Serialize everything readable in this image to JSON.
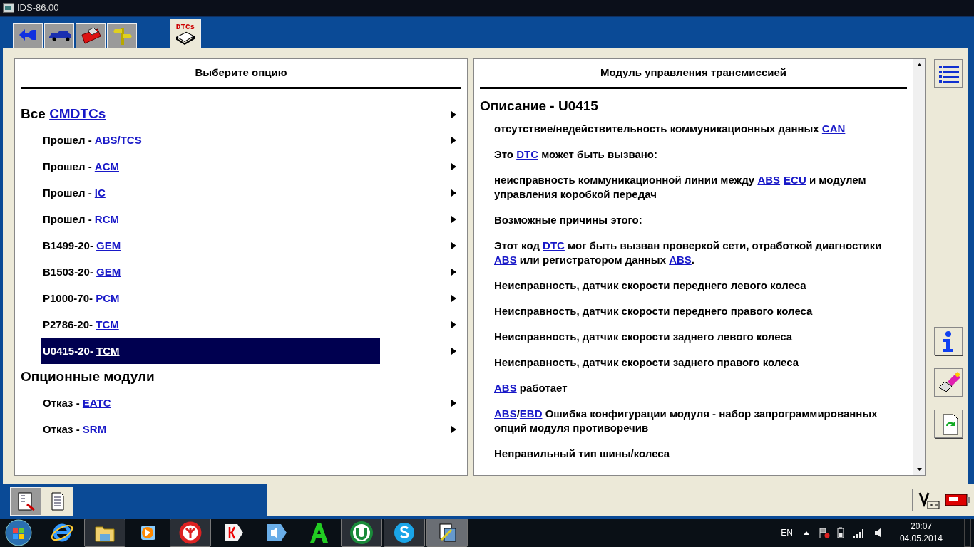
{
  "window": {
    "title": "IDS-86.00"
  },
  "toolbar_tabs": [
    {
      "kind": "back",
      "selected": false
    },
    {
      "kind": "car",
      "selected": false
    },
    {
      "kind": "toolbox",
      "selected": false
    },
    {
      "kind": "signpost",
      "selected": false
    },
    {
      "kind": "dtc",
      "label": "DTCs",
      "selected": true
    }
  ],
  "left_panel": {
    "title": "Выберите опцию",
    "groups": [
      {
        "heading": [
          {
            "kind": "plain",
            "text": "Все "
          },
          {
            "kind": "link",
            "text": "CMDTCs"
          }
        ],
        "arrow": true,
        "items": [
          {
            "prefix": "Прошел - ",
            "link": "ABS/TCS",
            "selected": false
          },
          {
            "prefix": "Прошел - ",
            "link": "ACM",
            "selected": false
          },
          {
            "prefix": "Прошел - ",
            "link": "IC",
            "selected": false
          },
          {
            "prefix": "Прошел - ",
            "link": "RCM",
            "selected": false
          },
          {
            "prefix": "B1499-20- ",
            "link": "GEM",
            "selected": false
          },
          {
            "prefix": "B1503-20- ",
            "link": "GEM",
            "selected": false
          },
          {
            "prefix": "P1000-70- ",
            "link": "PCM",
            "selected": false
          },
          {
            "prefix": "P2786-20- ",
            "link": "TCM",
            "selected": false
          },
          {
            "prefix": "U0415-20- ",
            "link": "TCM",
            "selected": true
          }
        ]
      },
      {
        "heading": [
          {
            "kind": "plain",
            "text": "Опционные модули"
          }
        ],
        "arrow": false,
        "items": [
          {
            "prefix": "Отказ - ",
            "link": "EATC",
            "selected": false
          },
          {
            "prefix": "Отказ - ",
            "link": "SRM",
            "selected": false
          }
        ]
      }
    ]
  },
  "right_panel": {
    "title": "Модуль управления трансмиссией",
    "heading": "Описание - U0415",
    "paragraphs": [
      [
        {
          "kind": "plain",
          "text": "отсутствие/недействительность коммуникационных данных "
        },
        {
          "kind": "link",
          "text": "CAN"
        }
      ],
      [
        {
          "kind": "plain",
          "text": "Это "
        },
        {
          "kind": "link",
          "text": "DTC"
        },
        {
          "kind": "plain",
          "text": " может быть вызвано:"
        }
      ],
      [
        {
          "kind": "plain",
          "text": "неисправность коммуникационной линии между "
        },
        {
          "kind": "link",
          "text": "ABS"
        },
        {
          "kind": "link",
          "text": "ECU"
        },
        {
          "kind": "plain",
          "text": " и модулем управления коробкой передач"
        }
      ],
      [
        {
          "kind": "plain",
          "text": "Возможные причины этого:"
        }
      ],
      [
        {
          "kind": "plain",
          "text": "Этот код "
        },
        {
          "kind": "link",
          "text": "DTC"
        },
        {
          "kind": "plain",
          "text": " мог быть вызван проверкой сети, отработкой диагностики "
        },
        {
          "kind": "link",
          "text": "ABS"
        },
        {
          "kind": "plain",
          "text": " или регистратором данных "
        },
        {
          "kind": "link",
          "text": "ABS"
        },
        {
          "kind": "plain",
          "text": "."
        }
      ],
      [
        {
          "kind": "plain",
          "text": "Неисправность, датчик скорости переднего левого колеса"
        }
      ],
      [
        {
          "kind": "plain",
          "text": "Неисправность, датчик скорости переднего правого колеса"
        }
      ],
      [
        {
          "kind": "plain",
          "text": "Неисправность, датчик скорости заднего левого колеса"
        }
      ],
      [
        {
          "kind": "plain",
          "text": "Неисправность, датчик скорости заднего правого колеса"
        }
      ],
      [
        {
          "kind": "link",
          "text": "ABS"
        },
        {
          "kind": "plain",
          "text": " работает"
        }
      ],
      [
        {
          "kind": "link",
          "text": "ABS"
        },
        {
          "kind": "plain",
          "text": "/"
        },
        {
          "kind": "link",
          "text": "EBD"
        },
        {
          "kind": "plain",
          "text": " Ошибка конфигурации модуля - набор запрограммированных опций модуля противоречив"
        }
      ],
      [
        {
          "kind": "plain",
          "text": "Неправильный тип шины/колеса"
        }
      ]
    ]
  },
  "side_buttons": [
    {
      "kind": "list"
    },
    {
      "kind": "info"
    },
    {
      "kind": "eraser"
    },
    {
      "kind": "refresh-page"
    }
  ],
  "bottom_tabs": [
    {
      "kind": "report",
      "selected": true
    },
    {
      "kind": "document",
      "selected": false
    }
  ],
  "taskbar": {
    "apps": [
      {
        "kind": "ie",
        "running": false,
        "selected": false
      },
      {
        "kind": "explorer",
        "running": true,
        "selected": false
      },
      {
        "kind": "media",
        "running": false,
        "selected": false
      },
      {
        "kind": "yandex-browser",
        "running": true,
        "selected": false
      },
      {
        "kind": "yandex",
        "running": false,
        "selected": false
      },
      {
        "kind": "speaker",
        "running": false,
        "selected": false
      },
      {
        "kind": "letter-a",
        "running": false,
        "selected": false
      },
      {
        "kind": "torrent",
        "running": true,
        "selected": false
      },
      {
        "kind": "skype",
        "running": true,
        "selected": false
      },
      {
        "kind": "ids",
        "running": true,
        "selected": true
      }
    ],
    "language": "EN",
    "time": "20:07",
    "date": "04.05.2014"
  }
}
